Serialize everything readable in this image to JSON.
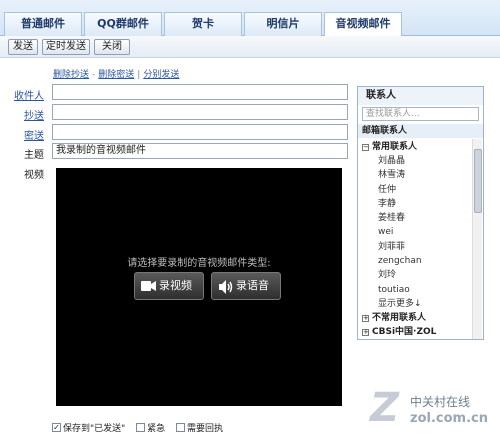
{
  "tabs": [
    {
      "label": "普通邮件",
      "active": false
    },
    {
      "label": "QQ群邮件",
      "active": false
    },
    {
      "label": "贺卡",
      "active": false
    },
    {
      "label": "明信片",
      "active": false
    },
    {
      "label": "音视频邮件",
      "active": true
    }
  ],
  "toolbar": {
    "send": "发送",
    "scheduled_send": "定时发送",
    "close": "关闭"
  },
  "links": {
    "remove_cc": "删除抄送",
    "remove_bcc": "删除密送",
    "separate_send": "分别发送"
  },
  "form": {
    "to_label": "收件人",
    "to_value": "",
    "cc_label": "抄送",
    "cc_value": "",
    "bcc_label": "密送",
    "bcc_value": "",
    "subject_label": "主题",
    "subject_value": "我录制的音视频邮件",
    "video_label": "视频"
  },
  "video": {
    "prompt": "请选择要录制的音视频邮件类型:",
    "record_video": "录视频",
    "record_audio": "录语音"
  },
  "options": {
    "save_sent": "保存到\"已发送\"",
    "urgent": "紧急",
    "receipt": "需要回执",
    "save_sent_checked": true
  },
  "contacts": {
    "title": "联系人",
    "search_placeholder": "查找联系人...",
    "mailbox_label": "邮箱联系人",
    "frequent_group": "常用联系人",
    "frequent": [
      "刘晶晶",
      "林雪涛",
      "任仲",
      "李静",
      "姜桂春",
      "wei",
      "刘菲菲",
      "zengchan",
      "刘玲",
      "toutiao"
    ],
    "show_more": "显示更多↓",
    "infrequent_group": "不常用联系人",
    "cbsi_group": "CBSi中国·ZOL"
  },
  "watermark": {
    "line1": "中关村在线",
    "line2": "zol.com.cn"
  }
}
